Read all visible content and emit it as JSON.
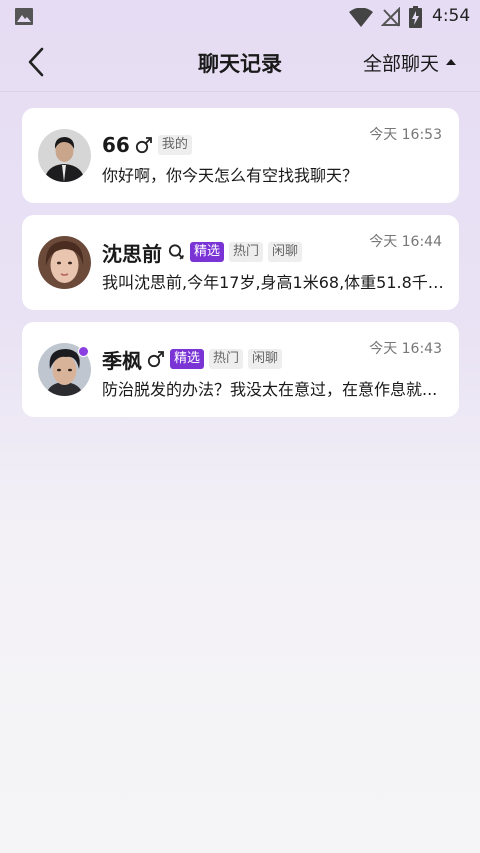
{
  "status_bar": {
    "time": "4:54",
    "icons": [
      "gallery-icon",
      "wifi-icon",
      "no-signal-icon",
      "battery-charging-icon"
    ]
  },
  "header": {
    "title": "聊天记录",
    "filter_label": "全部聊天",
    "icons": [
      "back-arrow-icon",
      "triangle-up-icon"
    ]
  },
  "chats": [
    {
      "name": "66",
      "symbol_icon": "male-icon",
      "tags": [
        {
          "text": "我的",
          "style": "gray"
        }
      ],
      "time": "今天 16:53",
      "message": "你好啊，你今天怎么有空找我聊天？",
      "online": false
    },
    {
      "name": "沈思前",
      "symbol_icon": "female-icon",
      "tags": [
        {
          "text": "精选",
          "style": "purple"
        },
        {
          "text": "热门",
          "style": "gray"
        },
        {
          "text": "闲聊",
          "style": "gray"
        }
      ],
      "time": "今天 16:44",
      "message": "我叫沈思前,今年17岁,身高1米68,体重51.8千克...",
      "online": false
    },
    {
      "name": "季枫",
      "symbol_icon": "male-icon",
      "tags": [
        {
          "text": "精选",
          "style": "purple"
        },
        {
          "text": "热门",
          "style": "gray"
        },
        {
          "text": "闲聊",
          "style": "gray"
        }
      ],
      "time": "今天 16:43",
      "message": "防治脱发的办法？我没太在意过，在意作息就...",
      "online": true
    }
  ],
  "colors": {
    "accent": "#7a34d6",
    "online_dot": "#8b3fe0",
    "card_bg": "#ffffff",
    "tag_gray_bg": "#eeeeee"
  }
}
